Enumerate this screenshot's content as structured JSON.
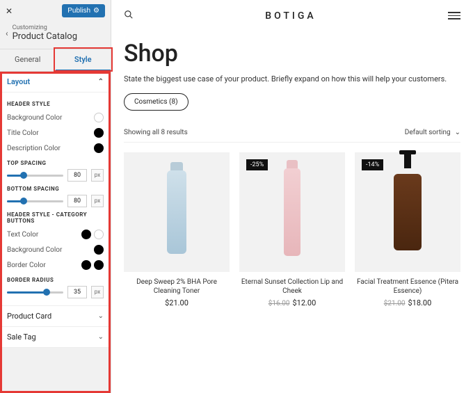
{
  "sidebar": {
    "publish_label": "Publish",
    "customizing_label": "Customizing",
    "section_title": "Product Catalog",
    "tabs": {
      "general": "General",
      "style": "Style"
    },
    "layout_label": "Layout",
    "header_style_label": "HEADER STYLE",
    "bg_color_label": "Background Color",
    "title_color_label": "Title Color",
    "desc_color_label": "Description Color",
    "top_spacing_label": "TOP SPACING",
    "top_spacing_value": "80",
    "bottom_spacing_label": "BOTTOM SPACING",
    "bottom_spacing_value": "80",
    "unit": "px",
    "cat_buttons_label": "HEADER STYLE - CATEGORY BUTTONS",
    "text_color_label": "Text Color",
    "bg_color_label2": "Background Color",
    "border_color_label": "Border Color",
    "border_radius_label": "BORDER RADIUS",
    "border_radius_value": "35",
    "product_card_label": "Product Card",
    "sale_tag_label": "Sale Tag"
  },
  "preview": {
    "logo": "BOTIGA",
    "shop_title": "Shop",
    "shop_desc": "State the biggest use case of your product. Briefly expand on how this will help your customers.",
    "category_pill": "Cosmetics (8)",
    "result_count": "Showing all 8 results",
    "sort_label": "Default sorting",
    "products": [
      {
        "name": "Deep Sweep 2% BHA Pore Cleaning Toner",
        "price": "$21.00",
        "old_price": "",
        "sale": ""
      },
      {
        "name": "Eternal Sunset Collection Lip and Cheek",
        "price": "$12.00",
        "old_price": "$16.00",
        "sale": "-25%"
      },
      {
        "name": "Facial Treatment Essence (Pitera Essence)",
        "price": "$18.00",
        "old_price": "$21.00",
        "sale": "-14%"
      }
    ]
  }
}
